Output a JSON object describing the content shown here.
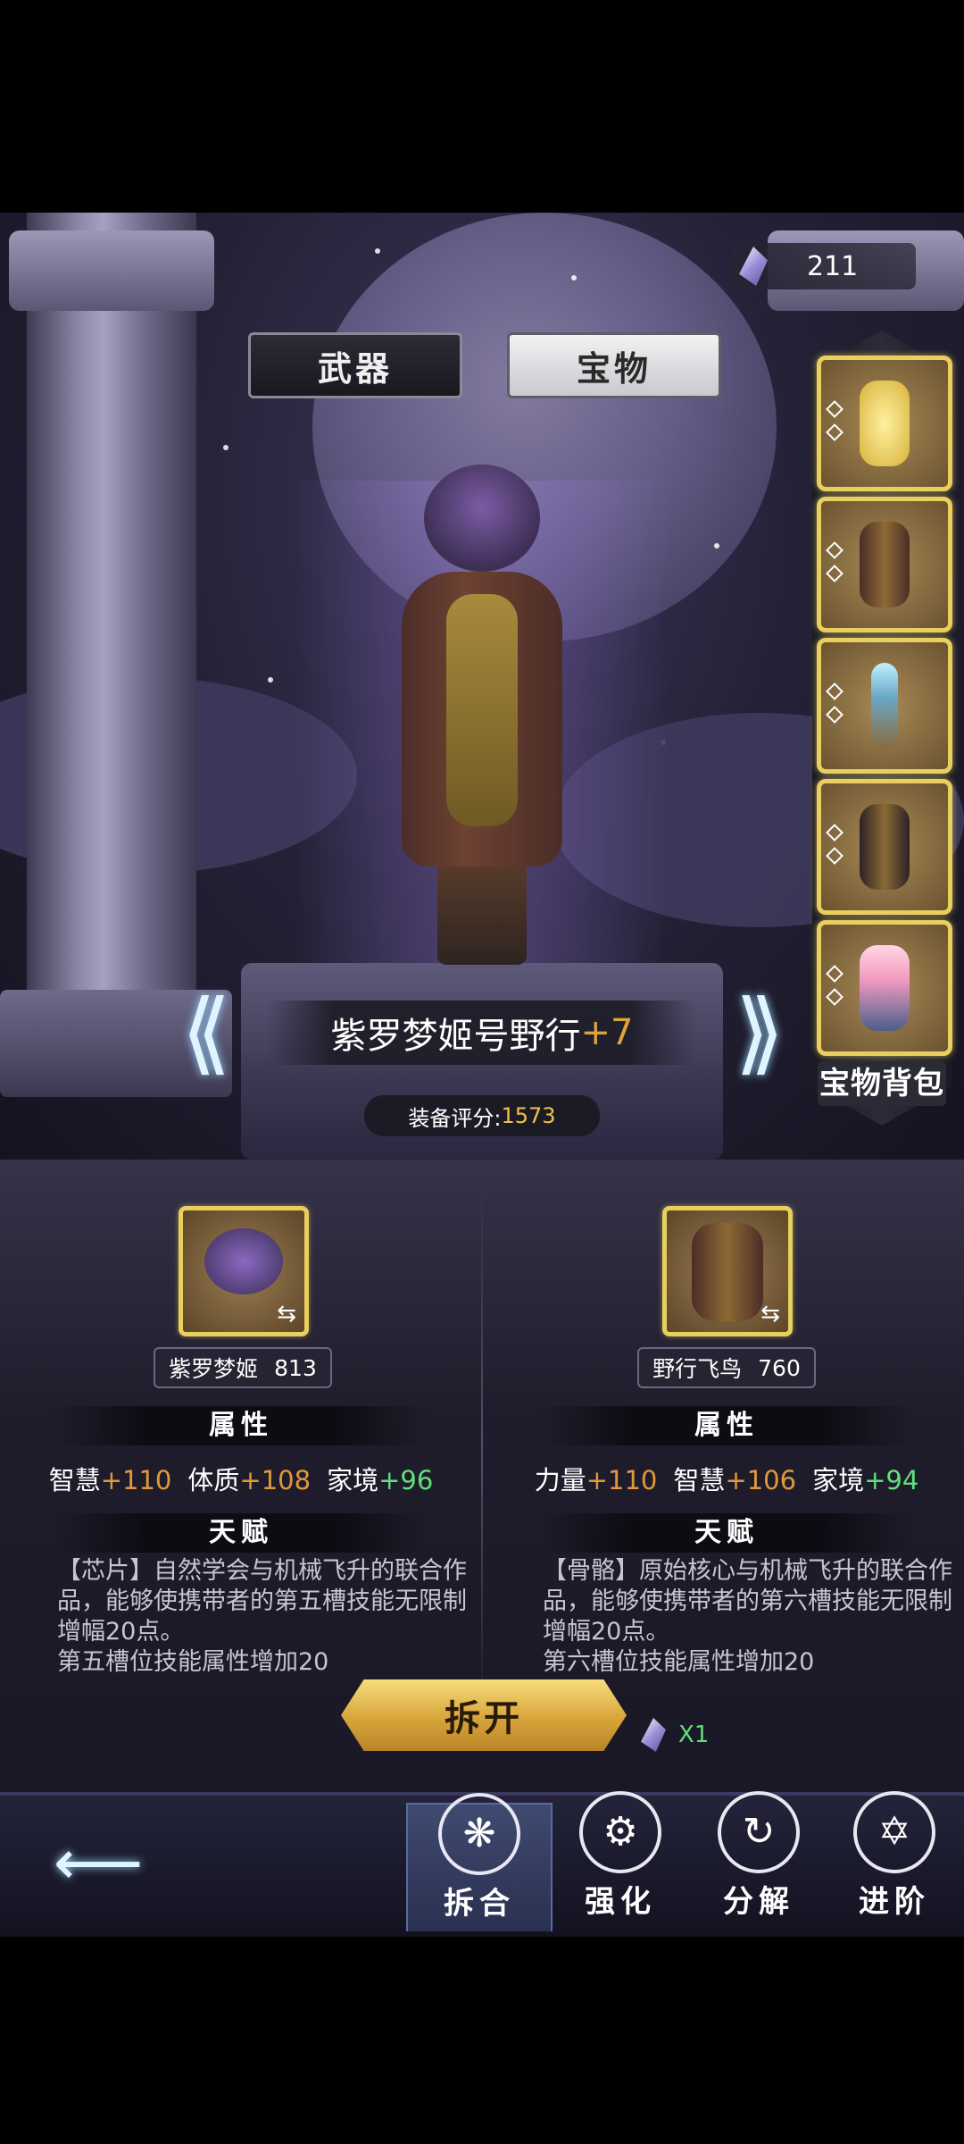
{
  "currency": {
    "icon": "crystal-icon",
    "amount": "211"
  },
  "tabs": {
    "weapon": "武器",
    "treasure": "宝物",
    "active": "treasure"
  },
  "slots": [
    {
      "name": "yellow-gem-amulet-icon"
    },
    {
      "name": "fur-armor-icon"
    },
    {
      "name": "crystal-staff-icon"
    },
    {
      "name": "dark-fur-armor-icon"
    },
    {
      "name": "flower-staff-icon"
    }
  ],
  "bag_label": "宝物背包",
  "item": {
    "name": "紫罗梦姬号野行",
    "plus": "+7",
    "score_label": "装备评分:",
    "score": "1573"
  },
  "left": {
    "name": "紫罗梦姬",
    "score": "813",
    "attr_title": "属性",
    "stats": [
      {
        "label": "智慧",
        "value": "+110",
        "color": "#e0993a"
      },
      {
        "label": "体质",
        "value": "+108",
        "color": "#e0993a"
      },
      {
        "label": "家境",
        "value": "+96",
        "color": "#5fe07a"
      }
    ],
    "talent_title": "天赋",
    "desc": "【芯片】自然学会与机械飞升的联合作品，能够使携带者的第五槽技能无限制增幅20点。",
    "desc2": "第五槽位技能属性增加20"
  },
  "right": {
    "name": "野行飞鸟",
    "score": "760",
    "attr_title": "属性",
    "stats": [
      {
        "label": "力量",
        "value": "+110",
        "color": "#e0993a"
      },
      {
        "label": "智慧",
        "value": "+106",
        "color": "#e0993a"
      },
      {
        "label": "家境",
        "value": "+94",
        "color": "#5fe07a"
      }
    ],
    "talent_title": "天赋",
    "desc": "【骨骼】原始核心与机械飞升的联合作品，能够使携带者的第六槽技能无限制增幅20点。",
    "desc2": "第六槽位技能属性增加20"
  },
  "dismantle": {
    "label": "拆开",
    "cost": "X1"
  },
  "nav": {
    "combine": "拆合",
    "strengthen": "强化",
    "decompose": "分解",
    "advance": "进阶"
  },
  "colors": {
    "gold": "#e8cf5e",
    "green": "#5fe07a",
    "orange": "#e0993a"
  }
}
